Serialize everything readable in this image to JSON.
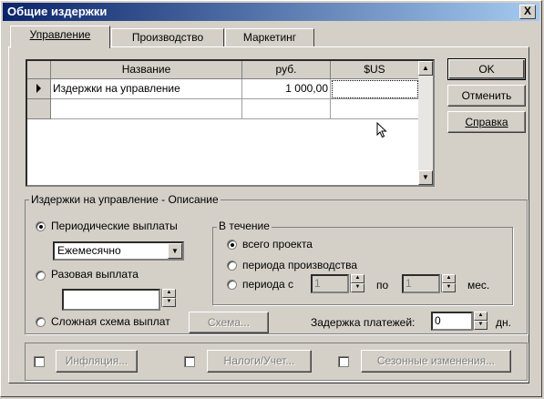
{
  "window": {
    "title": "Общие издержки",
    "close_label": "X"
  },
  "tabs": [
    {
      "label": "Управление",
      "active": true
    },
    {
      "label": "Производство",
      "active": false
    },
    {
      "label": "Маркетинг",
      "active": false
    }
  ],
  "grid": {
    "columns": [
      "Название",
      "руб.",
      "$US"
    ],
    "rows": [
      {
        "name": "Издержки на управление",
        "rub": "1 000,00",
        "usd": ""
      },
      {
        "name": "",
        "rub": "",
        "usd": ""
      }
    ]
  },
  "buttons": {
    "ok": "OK",
    "cancel": "Отменить",
    "help": "Справка"
  },
  "description": {
    "title": "Издержки на управление - Описание",
    "periodic_label": "Периодические выплаты",
    "frequency_value": "Ежемесячно",
    "single_label": "Разовая выплата",
    "single_value": "",
    "complex_label": "Сложная схема выплат",
    "scheme_button": "Схема...",
    "during_title": "В течение",
    "whole_project": "всего проекта",
    "production_period": "периода производства",
    "period_from": "периода с",
    "from_value": "1",
    "to_label": "по",
    "to_value": "1",
    "months_label": "мес.",
    "delay_label": "Задержка платежей:",
    "delay_value": "0",
    "days_label": "дн."
  },
  "footer": {
    "inflation_button": "Инфляция...",
    "taxes_button": "Налоги/Учет...",
    "seasonal_button": "Сезонные изменения..."
  }
}
